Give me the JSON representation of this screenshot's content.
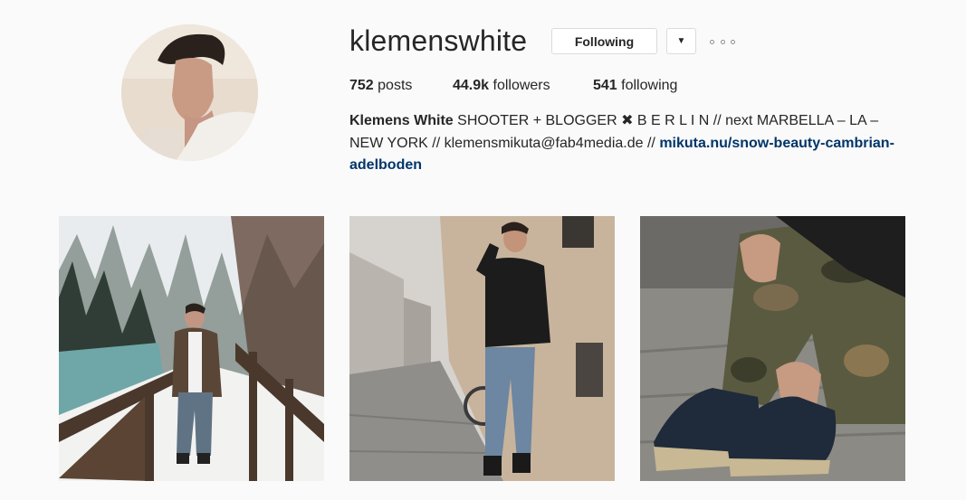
{
  "profile": {
    "username": "klemenswhite",
    "follow_label": "Following",
    "dropdown_icon": "▼",
    "stats": {
      "posts_count": "752",
      "posts_label": "posts",
      "followers_count": "44.9k",
      "followers_label": "followers",
      "following_count": "541",
      "following_label": "following"
    },
    "bio": {
      "name": "Klemens White",
      "line1_text": "SHOOTER + BLOGGER ✖ B E R L I N // next MARBELLA – LA –",
      "line2_text": "NEW YORK // klemensmikuta@fab4media.de //",
      "link_part1": "mikuta.nu/snow-beauty-cambrian-",
      "link_part2": "adelboden"
    }
  },
  "posts": [
    {
      "description": "man on snowy wooden bridge in winter forest"
    },
    {
      "description": "man in leather jacket leaning on building wall on cobblestone street"
    },
    {
      "description": "close-up of dark sneakers and camouflage pants on cobblestone"
    }
  ],
  "colors": {
    "link": "#003569",
    "text": "#262626",
    "border": "#dbdbdb",
    "background": "#fafafa"
  }
}
